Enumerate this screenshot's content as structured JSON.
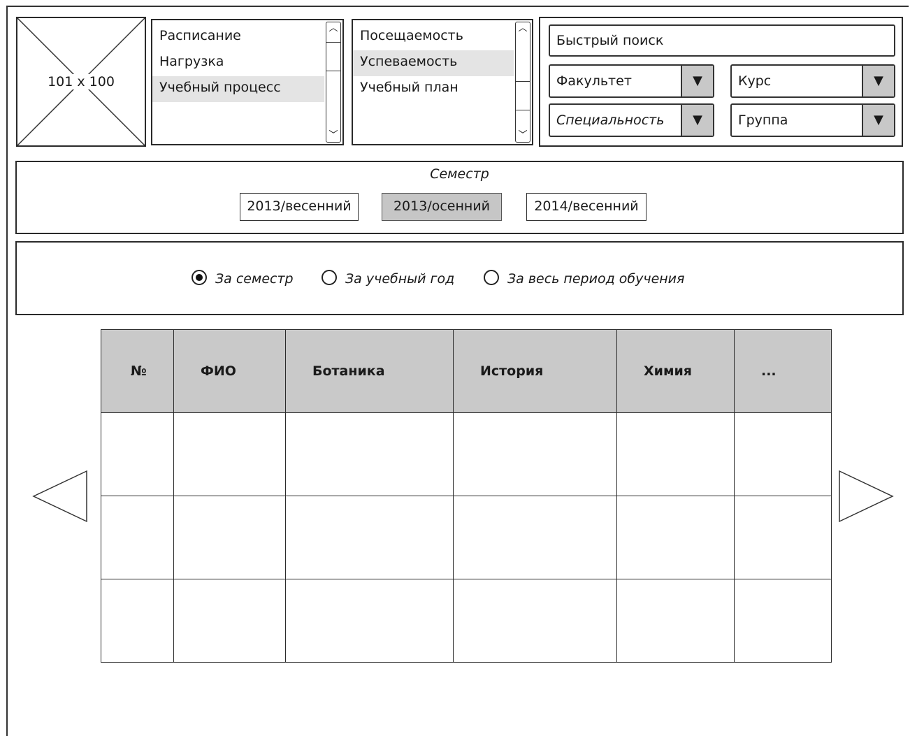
{
  "image_placeholder": {
    "label": "101 x 100"
  },
  "menu_main": {
    "items": [
      {
        "label": "Расписание",
        "selected": false
      },
      {
        "label": "Нагрузка",
        "selected": false
      },
      {
        "label": "Учебный процесс",
        "selected": true
      }
    ]
  },
  "menu_sub": {
    "items": [
      {
        "label": "Посещаемость",
        "selected": false
      },
      {
        "label": "Успеваемость",
        "selected": true
      },
      {
        "label": "Учебный план",
        "selected": false
      }
    ]
  },
  "filters": {
    "search": "Быстрый поиск",
    "faculty": "Факультет",
    "course": "Курс",
    "specialty": "Специальность",
    "group": "Группа"
  },
  "semester": {
    "title": "Семестр",
    "options": [
      "2013/весенний",
      "2013/осенний",
      "2014/весенний"
    ],
    "active": "2013/осенний"
  },
  "period": {
    "options": [
      "За семестр",
      "За учебный год",
      "За весь период обучения"
    ],
    "selected": "За семестр"
  },
  "table": {
    "headers": [
      "№",
      "ФИО",
      "Ботаника",
      "История",
      "Химия",
      "..."
    ],
    "rows": 3
  },
  "colors": {
    "border": "#2a2a2a",
    "selected_bg": "#e4e4e4",
    "header_bg": "#c9c9c9",
    "active_button_bg": "#c6c6c6"
  }
}
